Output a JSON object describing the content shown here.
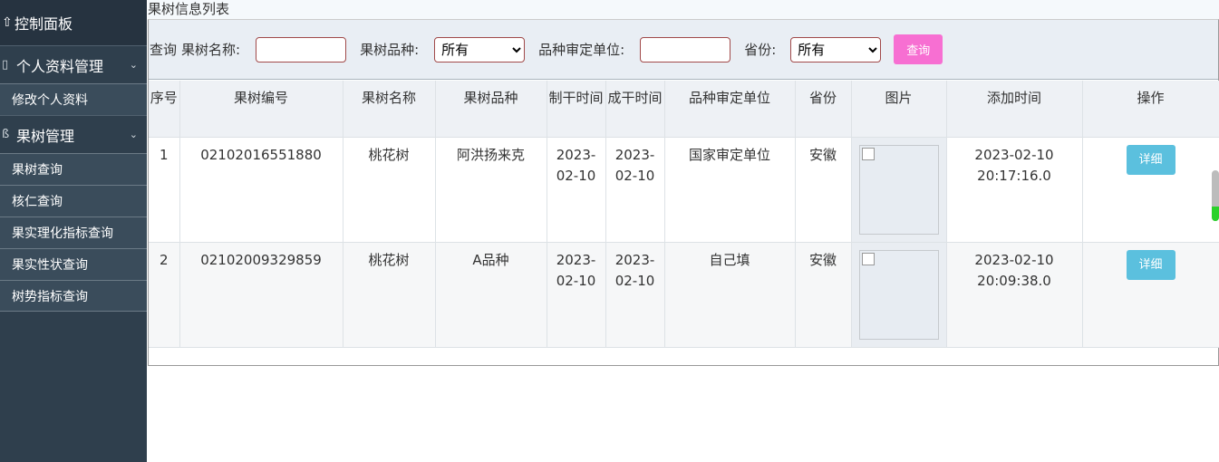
{
  "sidebar": {
    "header": "控制面板",
    "groups": [
      {
        "label": "个人资料管理",
        "items": [
          "修改个人资料"
        ]
      },
      {
        "label": "果树管理",
        "items": [
          "果树查询",
          "核仁查询",
          "果实理化指标查询",
          "果实性状查询",
          "树势指标查询"
        ]
      }
    ]
  },
  "breadcrumb": "果树信息列表",
  "search": {
    "query_label": "查询",
    "name_label": "果树名称:",
    "name_value": "",
    "variety_label": "果树品种:",
    "variety_selected": "所有",
    "unit_label": "品种审定单位:",
    "unit_value": "",
    "province_label": "省份:",
    "province_selected": "所有",
    "button": "查询"
  },
  "table": {
    "headers": [
      "序号",
      "果树编号",
      "果树名称",
      "果树品种",
      "制干时间",
      "成干时间",
      "品种审定单位",
      "省份",
      "图片",
      "添加时间",
      "操作"
    ],
    "rows": [
      {
        "index": "1",
        "code": "02102016551880",
        "name": "桃花树",
        "variety": "阿洪扬来克",
        "make_time": "2023-02-10",
        "dry_time": "2023-02-10",
        "unit": "国家审定单位",
        "province": "安徽",
        "added": "2023-02-10 20:17:16.0",
        "action": "详细"
      },
      {
        "index": "2",
        "code": "02102009329859",
        "name": "桃花树",
        "variety": "A品种",
        "make_time": "2023-02-10",
        "dry_time": "2023-02-10",
        "unit": "自己填",
        "province": "安徽",
        "added": "2023-02-10 20:09:38.0",
        "action": "详细"
      }
    ]
  }
}
